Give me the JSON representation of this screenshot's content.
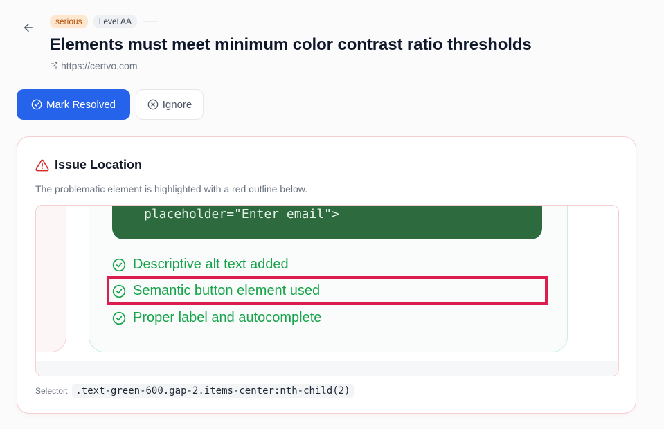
{
  "header": {
    "severity_badge": "serious",
    "level_badge": "Level AA",
    "title": "Elements must meet minimum color contrast ratio thresholds",
    "url": "https://certvo.com"
  },
  "actions": {
    "resolve_label": "Mark Resolved",
    "ignore_label": "Ignore"
  },
  "issue_location": {
    "title": "Issue Location",
    "description": "The problematic element is highlighted with a red outline below.",
    "preview": {
      "code_line": "placeholder=\"Enter email\">",
      "items": [
        "Descriptive alt text added",
        "Semantic button element used",
        "Proper label and autocomplete"
      ]
    },
    "selector_label": "Selector:",
    "selector_value": ".text-green-600.gap-2.items-center:nth-child(2)"
  },
  "colors": {
    "primary": "#2563eb",
    "serious_bg": "#fde7cf",
    "serious_text": "#b45309",
    "highlight": "#dc1e4e",
    "success": "#16a34a"
  }
}
